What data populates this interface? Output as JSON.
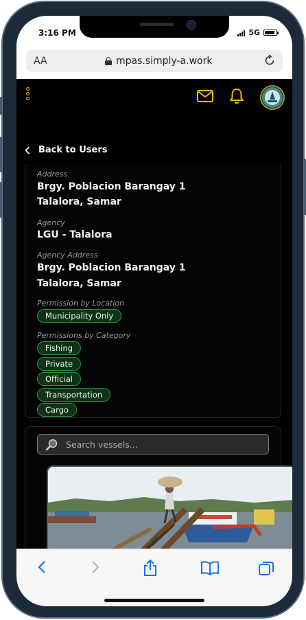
{
  "status_bar": {
    "time": "3:16 PM",
    "network": "5G",
    "battery_level": 0.85,
    "signal_bars": 4
  },
  "browser": {
    "text_size_label": "AA",
    "url": "mpas.simply-a.work"
  },
  "colors": {
    "accent": "#f2b705",
    "chip_bg": "#0f3318",
    "chip_border": "#2f8f3f",
    "app_bg": "#000000"
  },
  "header": {
    "icons": [
      "kebab-menu-icon",
      "mail-icon",
      "bell-icon",
      "avatar-logo"
    ]
  },
  "nav": {
    "back_label": "Back to Users"
  },
  "details": {
    "address_label": "Address",
    "address_line1": "Brgy. Poblacion Barangay 1",
    "address_line2": "Talalora, Samar",
    "agency_label": "Agency",
    "agency_value": "LGU - Talalora",
    "agency_address_label": "Agency Address",
    "agency_address_line1": "Brgy. Poblacion Barangay 1",
    "agency_address_line2": "Talalora, Samar",
    "permission_location_label": "Permission by Location",
    "permission_location_value": "Municipality Only",
    "permission_category_label": "Permissions by Category",
    "categories": [
      "Fishing",
      "Private",
      "Official",
      "Transportation",
      "Cargo"
    ]
  },
  "vessels": {
    "search_placeholder": "Search vessels..."
  },
  "toolbar": {
    "icons": [
      "back-arrow-icon",
      "forward-arrow-icon",
      "share-icon",
      "bookmarks-icon",
      "tabs-icon"
    ]
  }
}
